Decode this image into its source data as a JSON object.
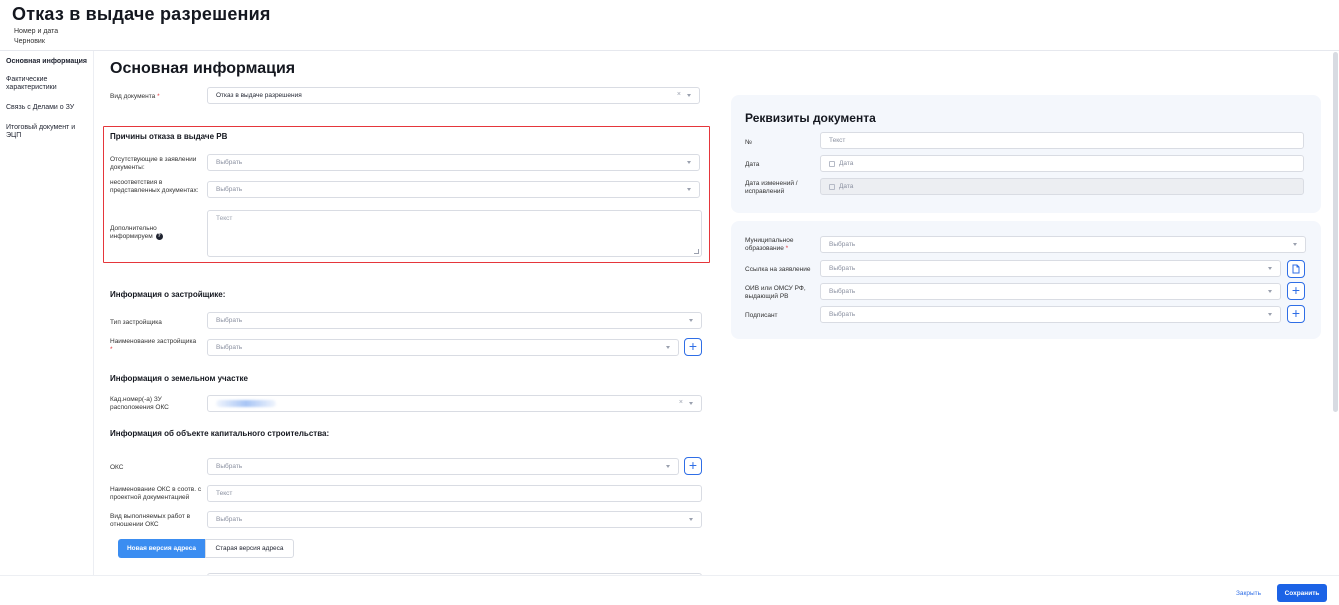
{
  "header": {
    "title": "Отказ в выдаче разрешения",
    "number_date": "Номер и дата",
    "status": "Черновик"
  },
  "sidebar": {
    "items": [
      {
        "label": "Основная информация"
      },
      {
        "label": "Фактические характеристики"
      },
      {
        "label": "Связь с Делами о ЗУ"
      },
      {
        "label": "Итоговый документ и ЭЦП"
      }
    ]
  },
  "main": {
    "title": "Основная информация",
    "doc_type": {
      "label": "Вид документа",
      "required_mark": "*",
      "value": "Отказ в выдаче разрешения"
    },
    "refusal": {
      "title": "Причины отказа в выдаче РВ",
      "missing_docs": {
        "label": "Отсутствующие в заявлении документы:",
        "placeholder": "Выбрать"
      },
      "mismatch": {
        "label": "несоответствия в представленных документах:",
        "placeholder": "Выбрать"
      },
      "additional": {
        "label": "Дополнительно информируем",
        "placeholder": "Текст",
        "help": "?"
      }
    },
    "developer": {
      "title": "Информация о застройщике:",
      "type": {
        "label": "Тип застройщика",
        "placeholder": "Выбрать"
      },
      "name": {
        "label": "Наименование застройщика",
        "required_mark": "*",
        "placeholder": "Выбрать"
      }
    },
    "land": {
      "title": "Информация о земельном участке",
      "cad": {
        "label": "Кад.номер(-а) ЗУ расположения ОКС"
      }
    },
    "oks": {
      "title": "Информация об объекте капитального строительства:",
      "oks": {
        "label": "ОКС",
        "placeholder": "Выбрать"
      },
      "name": {
        "label": "Наименование ОКС в соотв. с проектной документацией",
        "placeholder": "Текст"
      },
      "works": {
        "label": "Вид выполняемых работ в отношении ОКС",
        "placeholder": "Выбрать"
      }
    },
    "address_tabs": [
      "Новая версия адреса",
      "Старая версия адреса"
    ]
  },
  "requisites": {
    "title": "Реквизиты документа",
    "number": {
      "label": "№",
      "placeholder": "Текст"
    },
    "date": {
      "label": "Дата",
      "placeholder": "Дата"
    },
    "change_date": {
      "label": "Дата изменений / исправлений",
      "placeholder": "Дата"
    }
  },
  "org": {
    "municipal": {
      "label": "Муниципальное образование",
      "required_mark": "*",
      "placeholder": "Выбрать"
    },
    "link": {
      "label": "Ссылка на заявление",
      "placeholder": "Выбрать"
    },
    "oiv": {
      "label": "ОИВ или ОМСУ РФ, выдающий РВ",
      "placeholder": "Выбрать"
    },
    "signer": {
      "label": "Подписант",
      "placeholder": "Выбрать"
    }
  },
  "footer": {
    "close": "Закрыть",
    "save": "Сохранить"
  },
  "icons": {
    "clear": "×",
    "plus": "+",
    "help": "?"
  },
  "colors": {
    "accent": "#1c63e6",
    "tab_active": "#3b8df1",
    "highlight": "#e5363b",
    "card_bg": "#f4f7fc"
  }
}
